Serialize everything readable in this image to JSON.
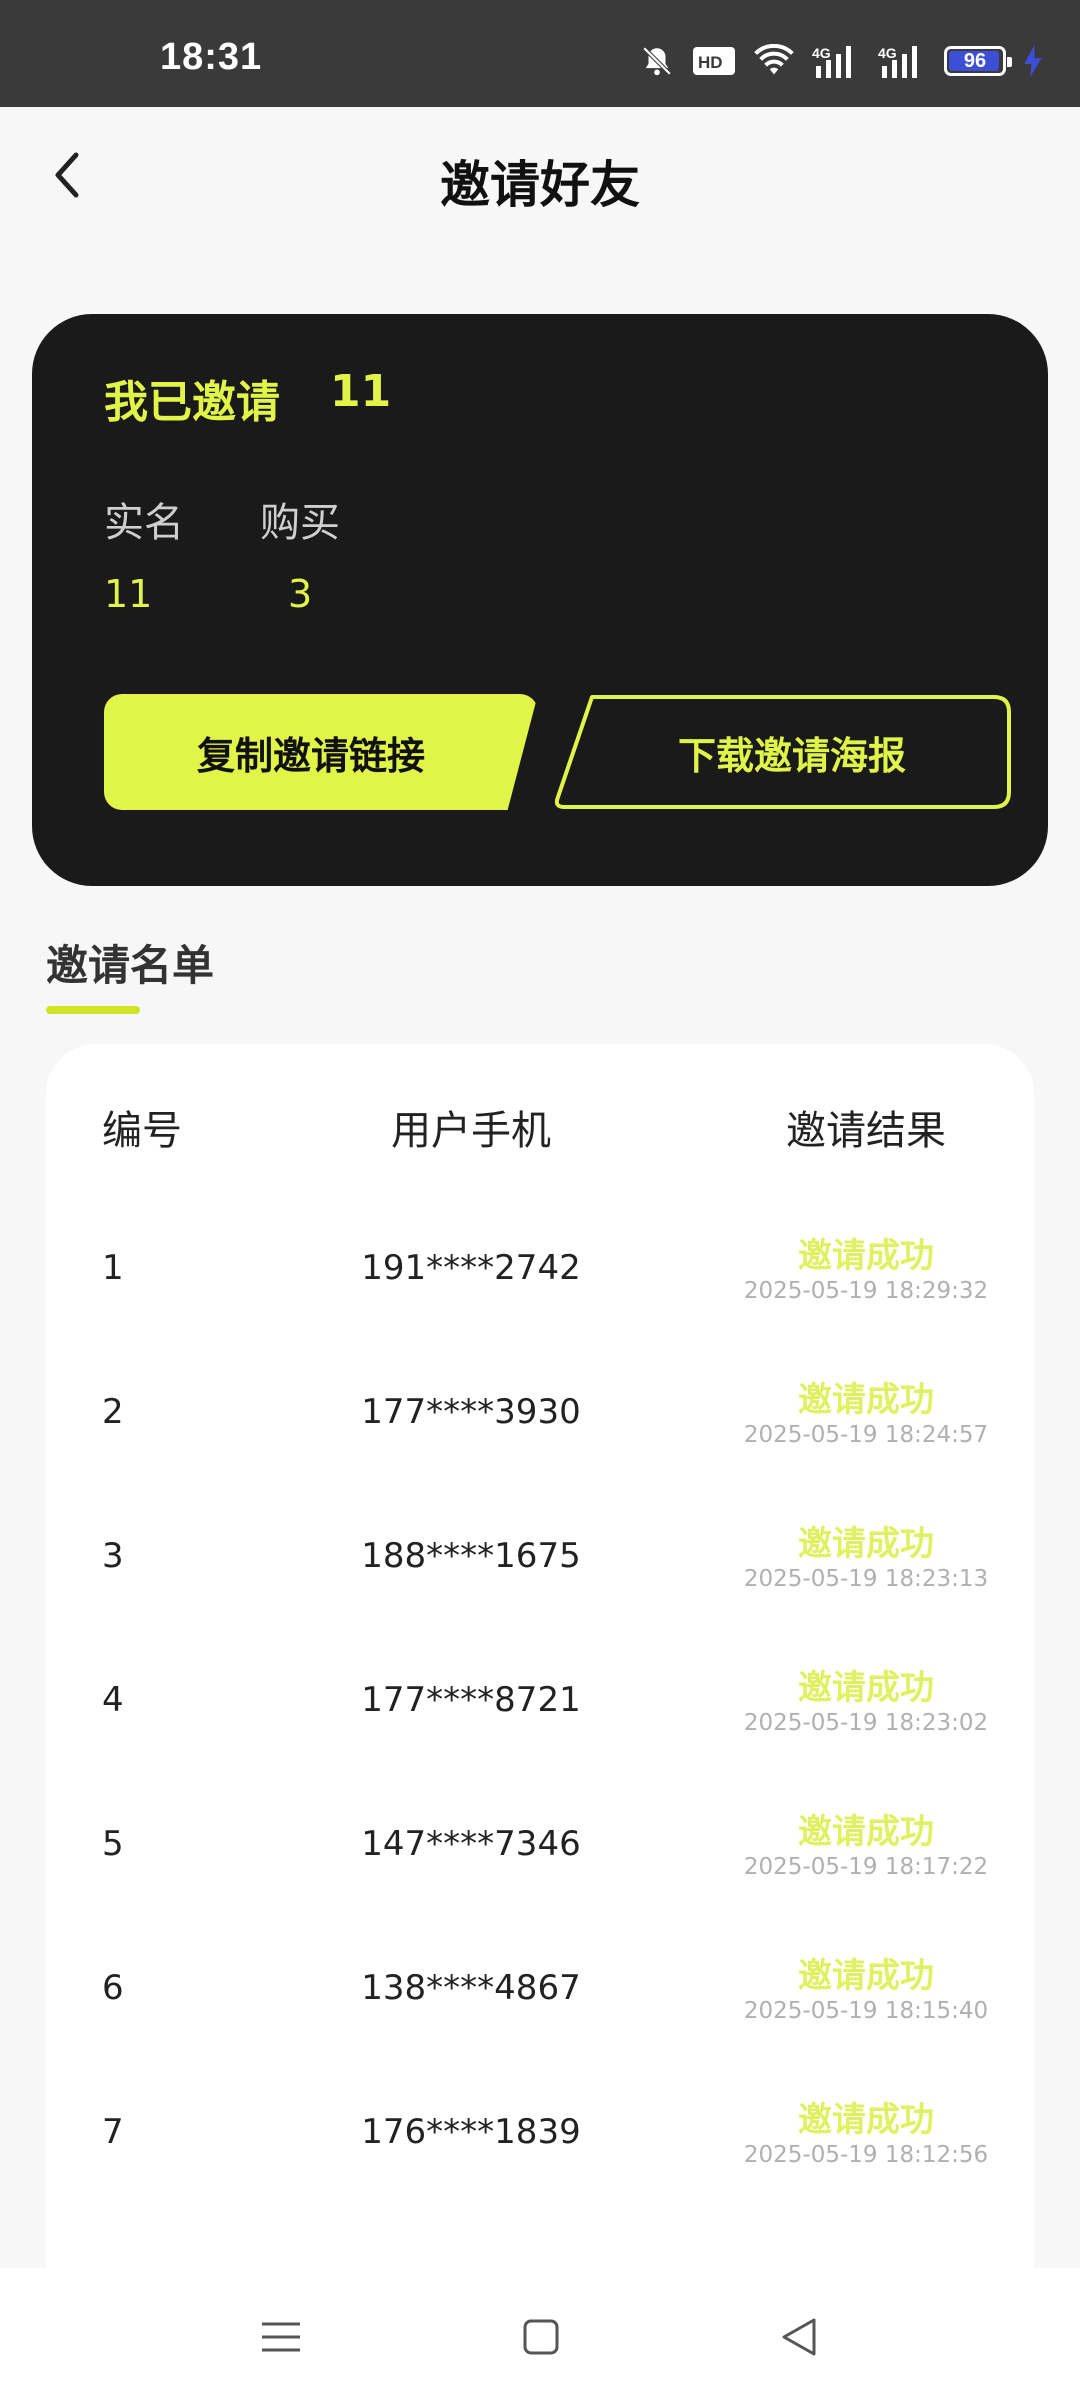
{
  "status_bar": {
    "time": "18:31",
    "battery": "96",
    "battery_level": 0.96,
    "icons": [
      "mute-icon",
      "hd-icon",
      "wifi-icon",
      "signal-4g-icon",
      "signal-4g-icon",
      "battery-icon",
      "charging-icon"
    ],
    "hd_label": "HD",
    "net_label": "4G"
  },
  "header": {
    "title": "邀请好友"
  },
  "summary": {
    "invited_label": "我已邀请",
    "invited_count": "11",
    "stats": [
      {
        "label": "实名",
        "value": "11"
      },
      {
        "label": "购买",
        "value": "3"
      }
    ],
    "copy_button": "复制邀请链接",
    "poster_button": "下载邀请海报"
  },
  "section": {
    "title": "邀请名单"
  },
  "table": {
    "headers": [
      "编号",
      "用户手机",
      "邀请结果"
    ],
    "rows": [
      {
        "no": "1",
        "phone": "191****2742",
        "result": "邀请成功",
        "time": "2025-05-19 18:29:32"
      },
      {
        "no": "2",
        "phone": "177****3930",
        "result": "邀请成功",
        "time": "2025-05-19 18:24:57"
      },
      {
        "no": "3",
        "phone": "188****1675",
        "result": "邀请成功",
        "time": "2025-05-19 18:23:13"
      },
      {
        "no": "4",
        "phone": "177****8721",
        "result": "邀请成功",
        "time": "2025-05-19 18:23:02"
      },
      {
        "no": "5",
        "phone": "147****7346",
        "result": "邀请成功",
        "time": "2025-05-19 18:17:22"
      },
      {
        "no": "6",
        "phone": "138****4867",
        "result": "邀请成功",
        "time": "2025-05-19 18:15:40"
      },
      {
        "no": "7",
        "phone": "176****1839",
        "result": "邀请成功",
        "time": "2025-05-19 18:12:56"
      }
    ]
  },
  "colors": {
    "accent": "#e1f548",
    "card_bg": "#1a1a1a",
    "page_bg": "#f7f7f7",
    "success_text": "#e0f060",
    "muted": "#b0b0b0"
  },
  "bottom_nav": {
    "icons": [
      "menu-icon",
      "home-square-icon",
      "back-triangle-icon"
    ]
  }
}
